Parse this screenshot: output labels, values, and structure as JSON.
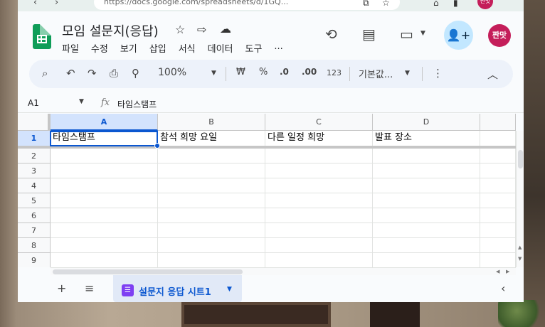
{
  "browser": {
    "url": "https://docs.google.com/spreadsheets/d/1GQ..."
  },
  "document": {
    "title": "모임 설문지(응답)",
    "menu": [
      "파일",
      "수정",
      "보기",
      "삽입",
      "서식",
      "데이터",
      "도구",
      "..."
    ],
    "user_avatar": "짠맛",
    "ext_avatar": "짠맛"
  },
  "toolbar": {
    "zoom": "100%",
    "currency": "₩",
    "percent": "%",
    "decrease_decimal": ".0",
    "increase_decimal": ".00",
    "number_format": "123",
    "font": "기본값..."
  },
  "formula_bar": {
    "cell_ref": "A1",
    "fx": "fx",
    "value": "타임스탬프"
  },
  "sheet": {
    "columns": [
      "A",
      "B",
      "C",
      "D"
    ],
    "rows": [
      "1",
      "2",
      "3",
      "4",
      "5",
      "6",
      "7",
      "8",
      "9"
    ],
    "header_row": [
      "타임스탬프",
      "참석 희망 요일",
      "다른 일정 희망",
      "발표 장소"
    ],
    "selected_cell": "A1"
  },
  "sheet_tabs": {
    "active_tab": "설문지 응답 시트1"
  },
  "colors": {
    "accent": "#0b57d0",
    "sheets_green": "#0f9d58",
    "tab_bg": "#e1e9f7",
    "form_icon": "#7e3ff2",
    "avatar": "#c41e5a"
  }
}
